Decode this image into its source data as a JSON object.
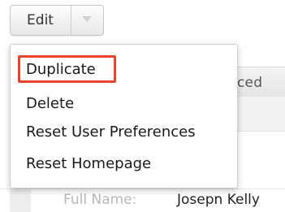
{
  "toolbar": {
    "edit_label": "Edit",
    "caret_icon": "chevron-down-icon"
  },
  "menu": {
    "items": [
      {
        "label": "Duplicate",
        "highlighted": true
      },
      {
        "label": "Delete"
      },
      {
        "label": "Reset User Preferences"
      },
      {
        "label": "Reset Homepage"
      }
    ],
    "highlight_color": "#e8442e"
  },
  "background": {
    "tab_fragment": "ced",
    "field_label": "Full Name:",
    "field_value": "Josepn Kelly"
  }
}
